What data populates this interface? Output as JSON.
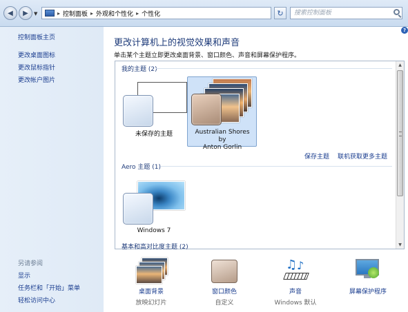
{
  "address_bar": {
    "breadcrumbs": [
      "控制面板",
      "外观和个性化",
      "个性化"
    ],
    "search_placeholder": "搜索控制面板"
  },
  "left_pane": {
    "links": [
      "控制面板主页",
      "更改桌面图标",
      "更改鼠标指针",
      "更改帐户图片"
    ],
    "see_also_title": "另请参阅",
    "see_also_links": [
      "显示",
      "任务栏和「开始」菜单",
      "轻松访问中心"
    ]
  },
  "main": {
    "title": "更改计算机上的视觉效果和声音",
    "subtitle": "单击某个主题立即更改桌面背景、窗口颜色、声音和屏幕保护程序。",
    "my_themes": {
      "header": "我的主题 (2)",
      "items": [
        {
          "label": "未保存的主题"
        },
        {
          "label_line1": "Australian Shores by",
          "label_line2": "Anton Gorlin"
        }
      ],
      "save_link": "保存主题",
      "more_link": "联机获取更多主题"
    },
    "aero_themes": {
      "header": "Aero 主题 (1)",
      "items": [
        {
          "label": "Windows 7"
        }
      ]
    },
    "high_contrast_header": "基本和高对比度主题 (2)"
  },
  "bottom_bar": {
    "items": [
      {
        "title": "桌面背景",
        "sub": "放映幻灯片"
      },
      {
        "title": "窗口颜色",
        "sub": "自定义"
      },
      {
        "title": "声音",
        "sub": "Windows 默认"
      },
      {
        "title": "屏幕保护程序",
        "sub": ""
      }
    ]
  },
  "colors": {
    "link": "#1a3d8f",
    "title": "#1e3b7a",
    "left_pane_bg": "#e6eff9",
    "selection": "#cfe2f8"
  }
}
